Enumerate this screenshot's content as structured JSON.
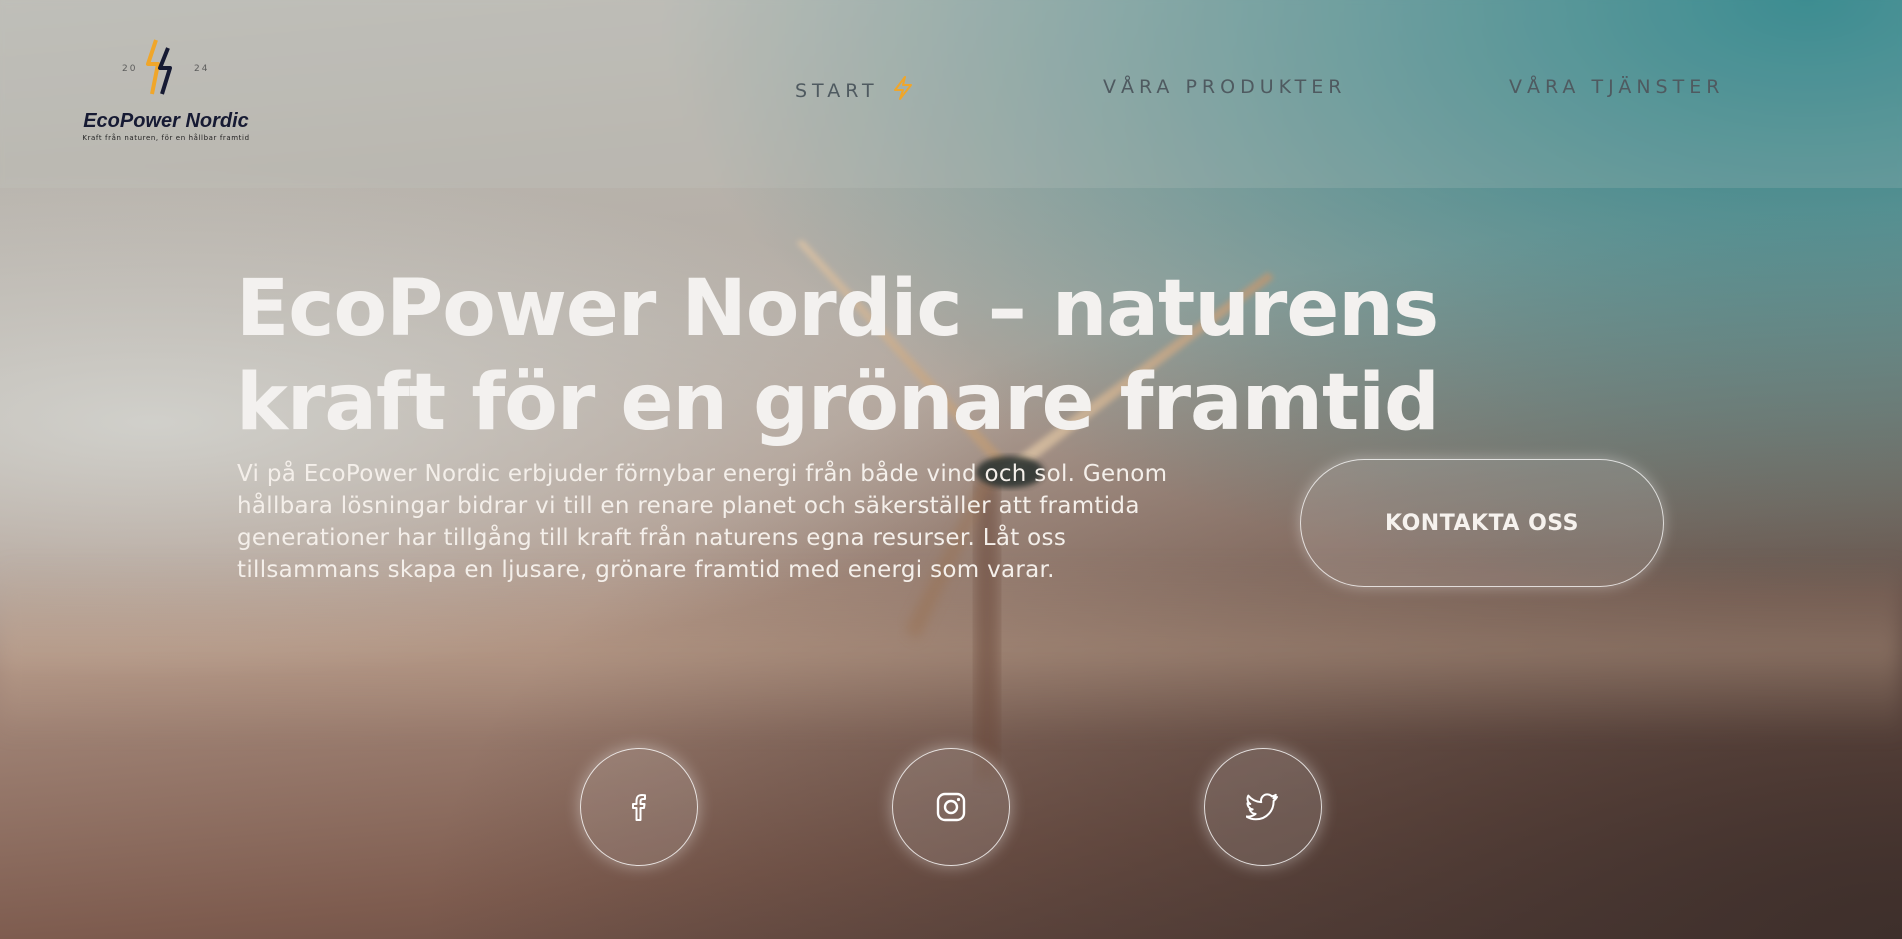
{
  "logo": {
    "name": "EcoPower Nordic",
    "tagline": "Kraft från naturen, för en hållbar framtid",
    "year_left": "20",
    "year_right": "24",
    "icon": "lightning-bolt-icon",
    "accent_color": "#f0a62a",
    "dark_color": "#161a33"
  },
  "nav": {
    "items": [
      {
        "label": "START",
        "icon": "lightning-bolt-icon"
      },
      {
        "label": "VÅRA PRODUKTER"
      },
      {
        "label": "VÅRA TJÄNSTER"
      }
    ]
  },
  "hero": {
    "title": "EcoPower Nordic – naturens kraft för en grönare framtid",
    "intro": "Vi på EcoPower Nordic erbjuder förnybar energi från både vind och sol. Genom hållbara lösningar bidrar vi till en renare planet och säkerställer att framtida generationer har tillgång till kraft från naturens egna resurser. Låt oss tillsammans skapa en ljusare, grönare framtid med energi som varar.",
    "cta_label": "KONTAKTA OSS"
  },
  "social": [
    {
      "icon": "facebook-icon"
    },
    {
      "icon": "instagram-icon"
    },
    {
      "icon": "twitter-icon"
    }
  ]
}
